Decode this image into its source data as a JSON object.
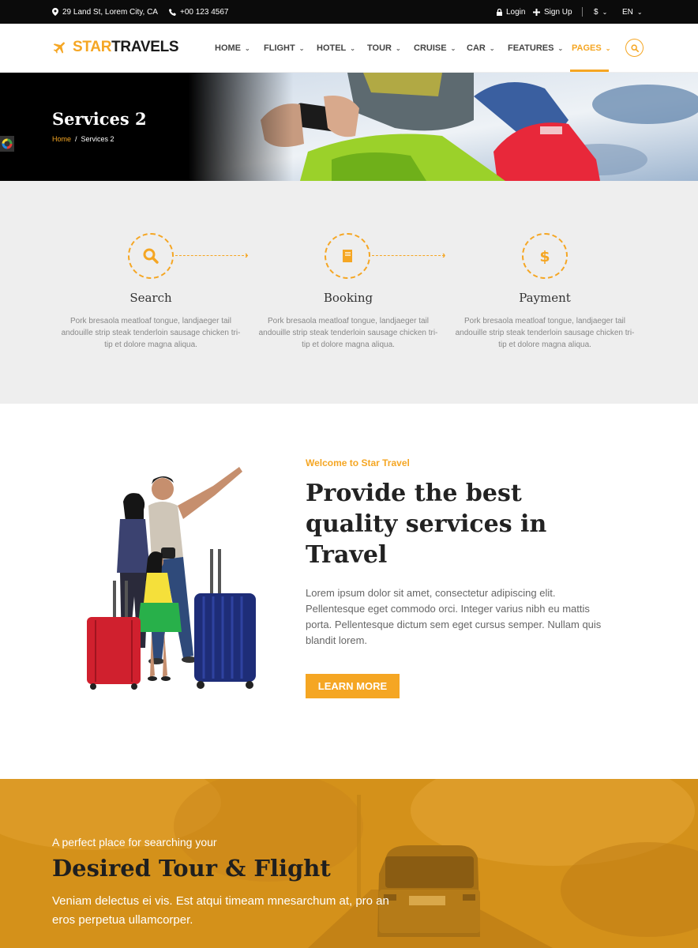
{
  "topbar": {
    "address": "29 Land St, Lorem City, CA",
    "phone": "+00 123 4567",
    "login": "Login",
    "signup": "Sign Up",
    "currency": "$",
    "language": "EN"
  },
  "header": {
    "logo_star": "STAR",
    "logo_travels": "TRAVELS",
    "nav": [
      {
        "label": "HOME"
      },
      {
        "label": "FLIGHT"
      },
      {
        "label": "HOTEL"
      },
      {
        "label": "TOUR"
      },
      {
        "label": "CRUISE"
      },
      {
        "label": "CAR"
      },
      {
        "label": "FEATURES"
      },
      {
        "label": "PAGES"
      }
    ],
    "active_index": 7
  },
  "hero": {
    "title": "Services 2",
    "breadcrumb_home": "Home",
    "breadcrumb_sep": "/",
    "breadcrumb_current": "Services 2"
  },
  "steps": [
    {
      "icon": "search-icon",
      "title": "Search",
      "text": "Pork bresaola meatloaf tongue, landjaeger tail andouille strip steak tenderloin sausage chicken tri-tip et dolore magna aliqua."
    },
    {
      "icon": "book-icon",
      "title": "Booking",
      "text": "Pork bresaola meatloaf tongue, landjaeger tail andouille strip steak tenderloin sausage chicken tri-tip et dolore magna aliqua."
    },
    {
      "icon": "dollar-icon",
      "title": "Payment",
      "text": "Pork bresaola meatloaf tongue, landjaeger tail andouille strip steak tenderloin sausage chicken tri-tip et dolore magna aliqua."
    }
  ],
  "about": {
    "subtitle": "Welcome to Star Travel",
    "title": "Provide the best quality services in Travel",
    "text": "Lorem ipsum dolor sit amet, consectetur adipiscing elit. Pellentesque eget commodo orci. Integer varius nibh eu mattis porta. Pellentesque dictum sem eget cursus semper. Nullam quis blandit lorem.",
    "button": "LEARN MORE"
  },
  "banner": {
    "subtitle": "A perfect place for searching your",
    "title": "Desired Tour & Flight",
    "text": "Veniam delectus ei vis. Est atqui timeam mnesarchum at, pro an eros perpetua ullamcorper."
  },
  "colors": {
    "accent": "#f5a623",
    "topbar": "#0b0b0b",
    "steps_bg": "#eeeeee",
    "banner_bg": "#d4911a"
  }
}
